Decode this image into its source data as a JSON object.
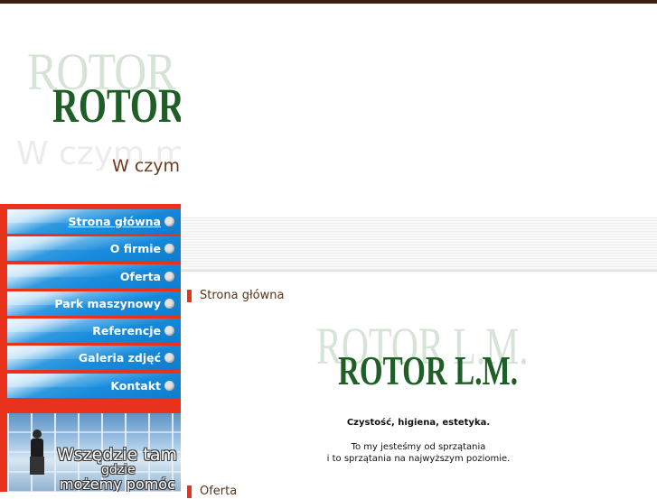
{
  "header": {
    "logo_ghost": "ROTOR L.M.",
    "logo": "ROTOR L.M.",
    "slogan_ghost": "W czym możemy pomóc",
    "slogan": "W czym możemy pomóc"
  },
  "nav": {
    "items": [
      {
        "label": "Strona główna",
        "active": true
      },
      {
        "label": "O firmie",
        "active": false
      },
      {
        "label": "Oferta",
        "active": false
      },
      {
        "label": "Park maszynowy",
        "active": false
      },
      {
        "label": "Referencje",
        "active": false
      },
      {
        "label": "Galeria zdjęć",
        "active": false
      },
      {
        "label": "Kontakt",
        "active": false
      }
    ]
  },
  "banner": {
    "line1": "Wszędzie tam",
    "line2": "gdzie",
    "line3": "możemy pomóc"
  },
  "main": {
    "section1_title": "Strona główna",
    "content_logo_ghost": "ROTOR L.M.",
    "content_logo": "ROTOR L.M.",
    "tagline": "Czystość, higiena, estetyka.",
    "intro_line1": "To my jesteśmy od sprzątania",
    "intro_line2": "i to sprzątania na najwyższym poziomie.",
    "section2_title": "Oferta"
  },
  "colors": {
    "accent_red": "#e8321b",
    "logo_green": "#1f5e26",
    "title_brown": "#5a3217",
    "nav_blue": "#1a8cdd"
  }
}
